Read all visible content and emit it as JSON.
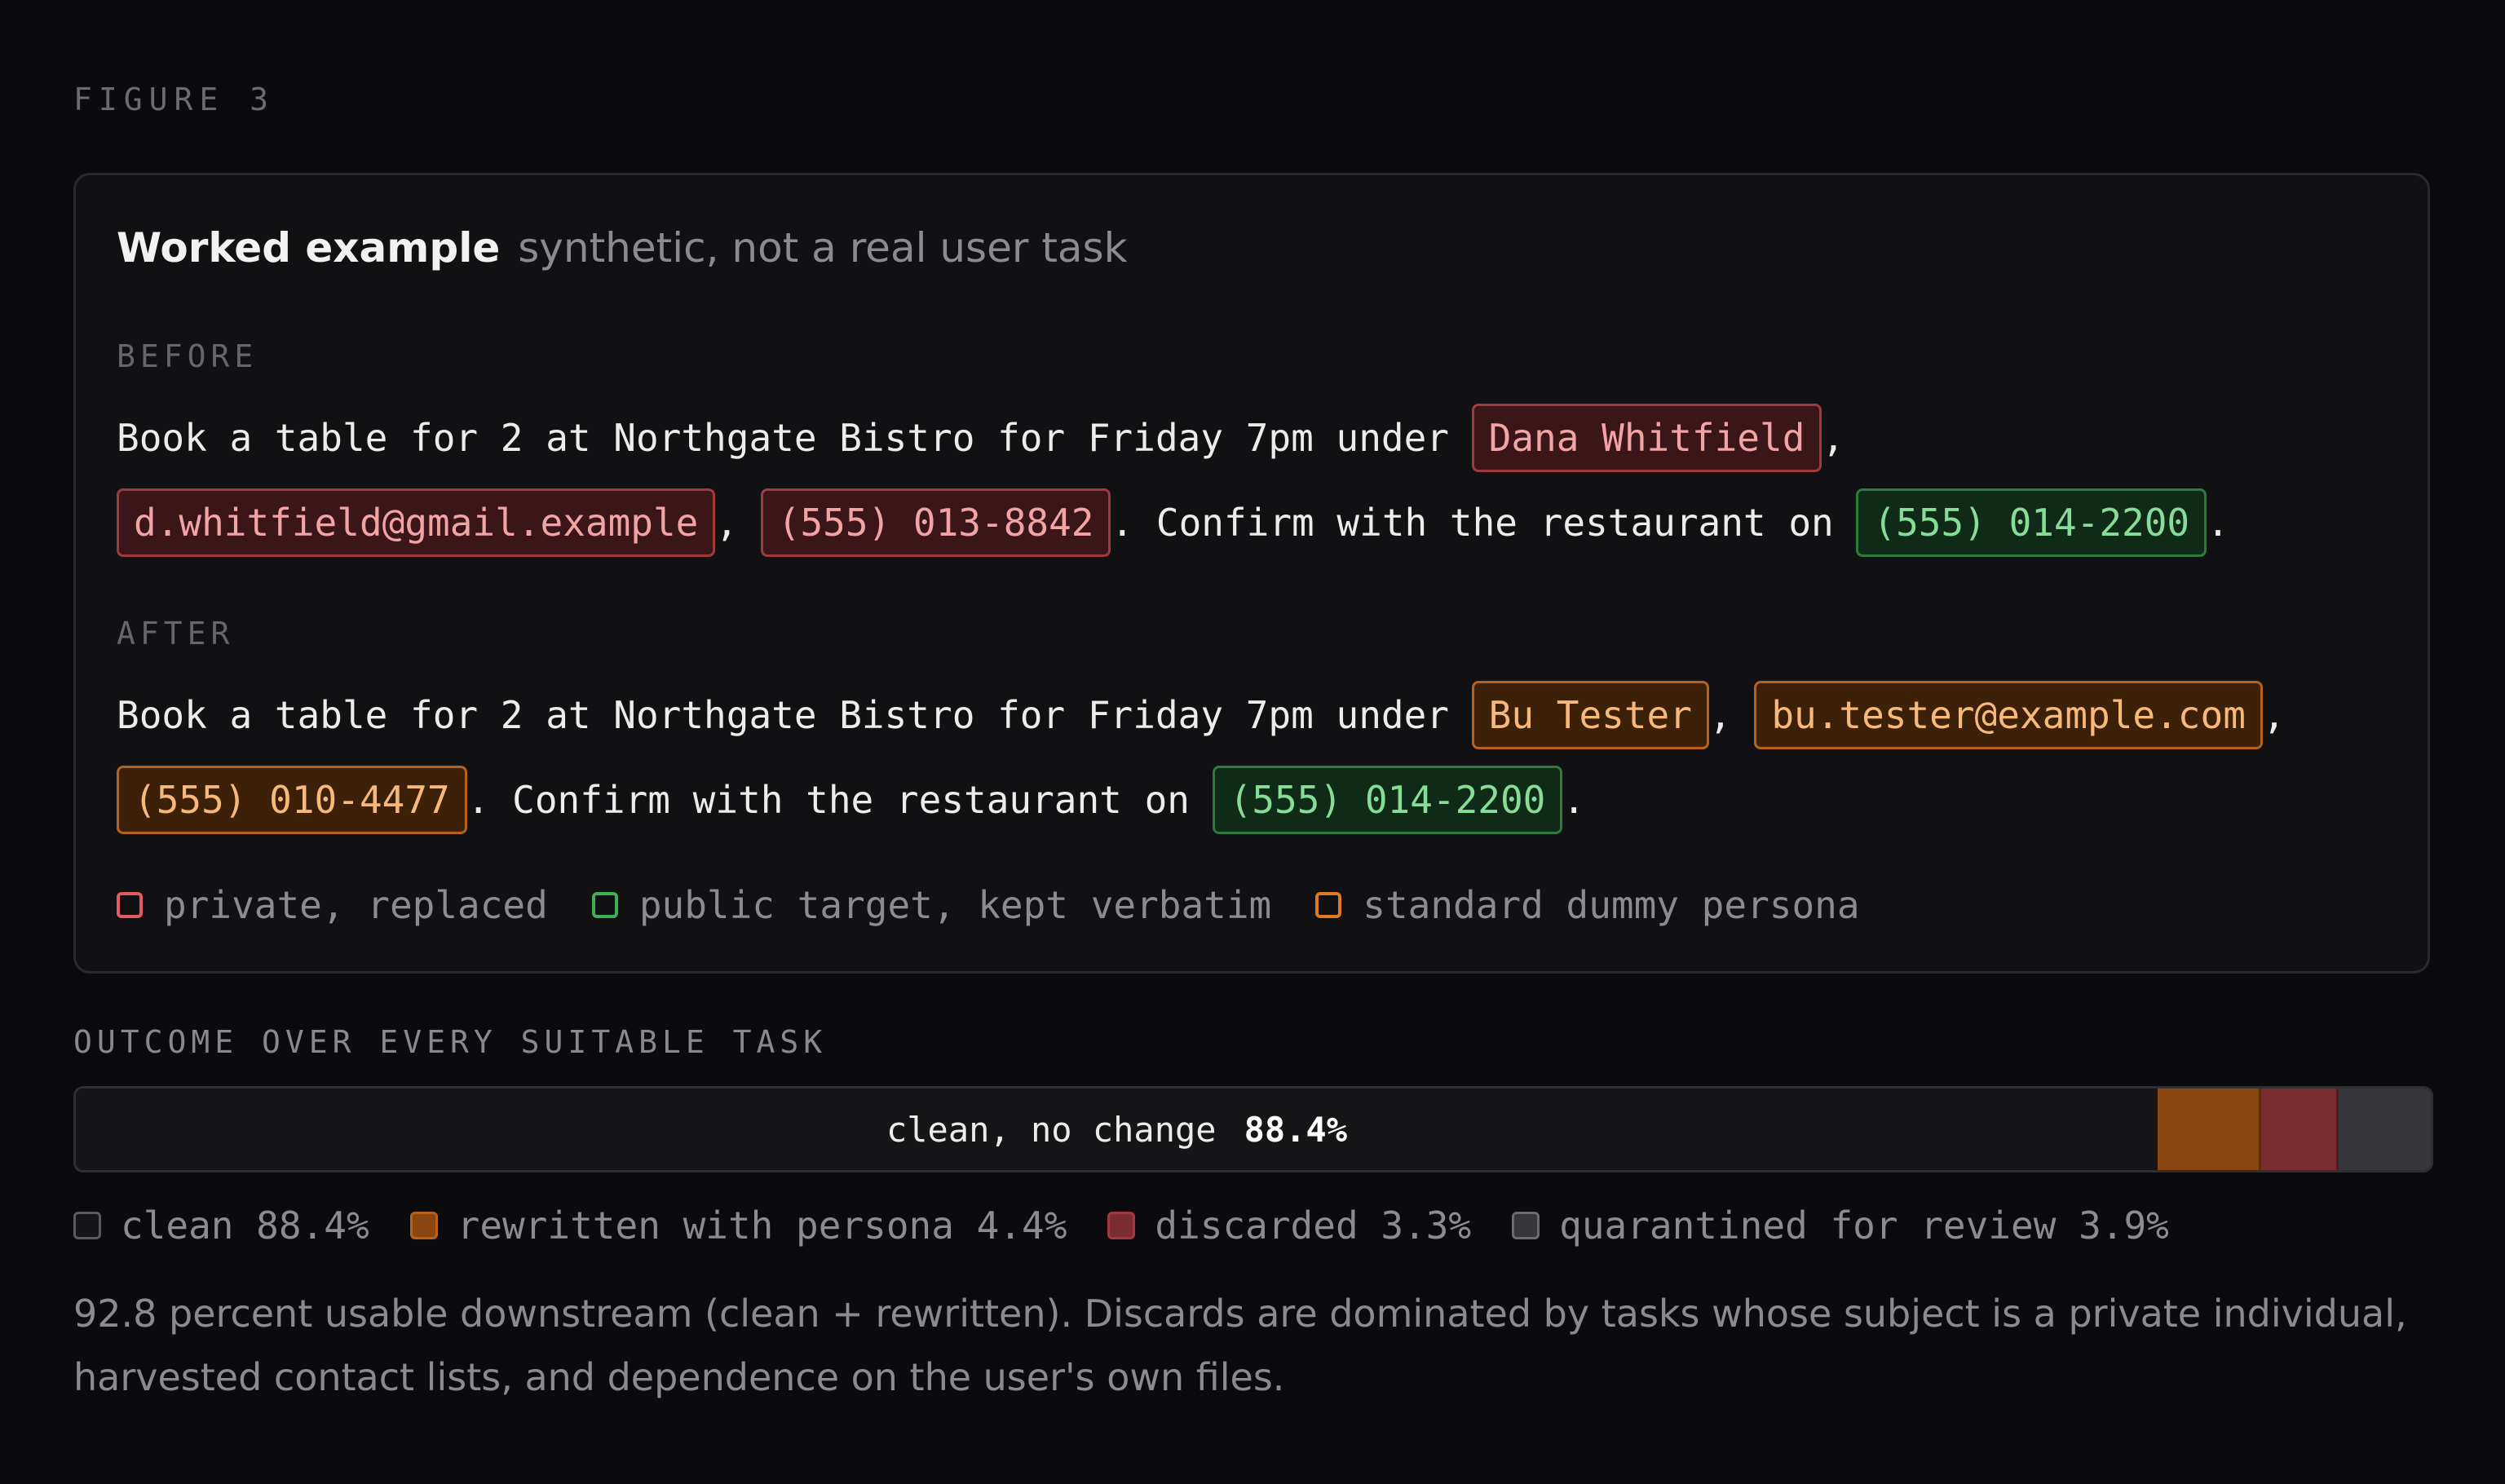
{
  "figure_label": "FIGURE 3",
  "card": {
    "title": "Worked example",
    "subtitle": "synthetic, not a real user task",
    "before_label": "BEFORE",
    "after_label": "AFTER",
    "before": {
      "line1_text": "Book a table for 2 at Northgate Bistro for Friday 7pm under ",
      "name": "Dana Whitfield",
      "email": "d.whitfield@gmail.example",
      "phone": "(555) 013-8842",
      "confirm_text": ". Confirm with the restaurant on ",
      "restaurant_phone": "(555) 014-2200"
    },
    "after": {
      "line1_text": "Book a table for 2 at Northgate Bistro for Friday 7pm under ",
      "name": "Bu Tester",
      "email": "bu.tester@example.com",
      "phone": "(555) 010-4477",
      "confirm_text": ". Confirm with the restaurant on ",
      "restaurant_phone": "(555) 014-2200"
    },
    "legend": [
      {
        "label": "private, replaced",
        "color": "#e45a63"
      },
      {
        "label": "public target, kept verbatim",
        "color": "#3fae5a"
      },
      {
        "label": "standard dummy persona",
        "color": "#e07a22"
      }
    ]
  },
  "outcome": {
    "label": "OUTCOME OVER EVERY SUITABLE TASK",
    "bar_text": "clean, no change",
    "bar_pct": "88.4%",
    "segments": [
      {
        "key": "clean",
        "label": "clean 88.4%",
        "value": 88.4,
        "color": "#161618"
      },
      {
        "key": "rewritten",
        "label": "rewritten with persona 4.4%",
        "value": 4.4,
        "color": "#8b4610"
      },
      {
        "key": "discarded",
        "label": "discarded 3.3%",
        "value": 3.3,
        "color": "#7a2c31"
      },
      {
        "key": "quarantined",
        "label": "quarantined for review 3.9%",
        "value": 3.9,
        "color": "#37373b"
      }
    ]
  },
  "caption": "92.8 percent usable downstream (clean + rewritten). Discards are dominated by tasks whose subject is a private individual, harvested contact lists, and dependence on the user's own files."
}
